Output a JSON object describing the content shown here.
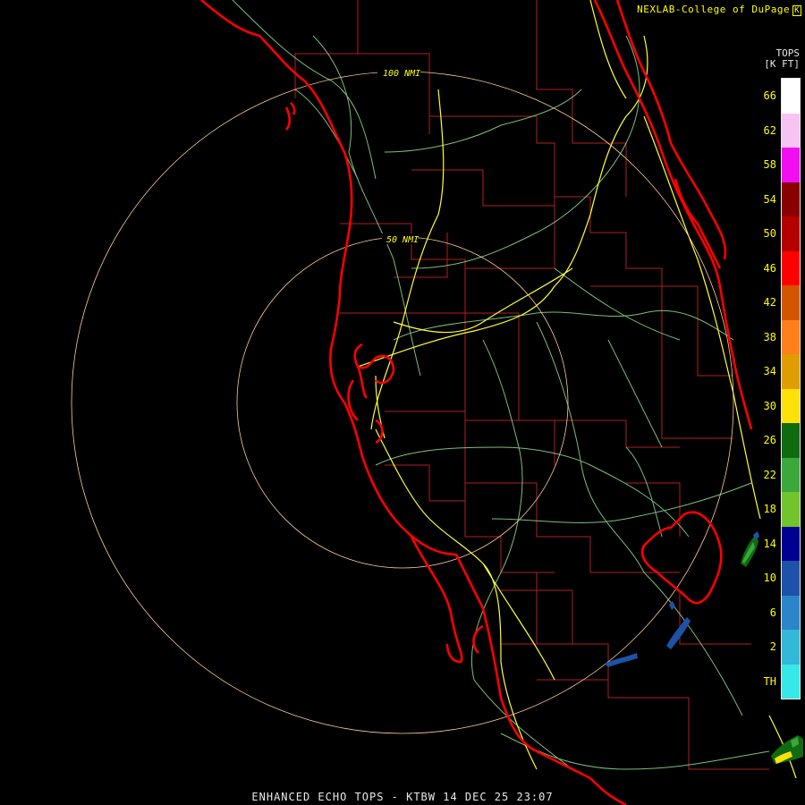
{
  "header": {
    "credit": "NEXLAB-College of DuPage",
    "credit_mark": "K"
  },
  "legend": {
    "title_line1": "TOPS",
    "title_line2": "[K FT]",
    "unit": "K FT",
    "ticks": [
      "66",
      "62",
      "58",
      "54",
      "50",
      "46",
      "42",
      "38",
      "34",
      "30",
      "26",
      "22",
      "18",
      "14",
      "10",
      "6",
      "2",
      "TH"
    ],
    "colors": [
      "#ffffff",
      "#f6c4f3",
      "#f10ff1",
      "#890000",
      "#b50000",
      "#ff0000",
      "#d45500",
      "#ff7f1b",
      "#e09d00",
      "#ffe10a",
      "#0f6b0f",
      "#3aa83a",
      "#72c42c",
      "#000090",
      "#1d52a8",
      "#2a86c9",
      "#32b9d8",
      "#37e8e8"
    ],
    "text_color": "#ffff00"
  },
  "range_rings": [
    {
      "label": "50 NMI",
      "radius_nmi": 50
    },
    {
      "label": "100 NMI",
      "radius_nmi": 100
    }
  ],
  "footer": {
    "product": "ENHANCED ECHO TOPS",
    "station": "KTBW",
    "timestamp": "14 DEC 25 23:07",
    "text": "ENHANCED ECHO TOPS - KTBW 14 DEC 25 23:07"
  },
  "colors": {
    "background": "#000000",
    "coastline": "#ff0000",
    "county_lines": "#b02020",
    "highways": "#ffff33",
    "roads": "#90e090",
    "rings": "#ffcc99"
  }
}
